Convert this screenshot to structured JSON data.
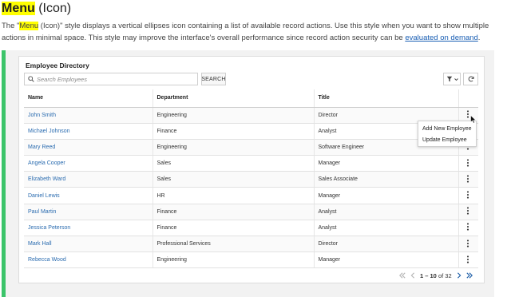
{
  "heading": {
    "highlight": "Menu",
    "rest": " (Icon)"
  },
  "description": {
    "part1": "The \"",
    "highlight": "Menu",
    "part2": " (Icon)\" style displays a vertical ellipses icon containing a list of available record actions. Use this style when you want to show multiple actions in minimal space. This style may improve the interface's overall performance since record action security can be ",
    "link": "evaluated on demand",
    "part3": "."
  },
  "card": {
    "title": "Employee Directory",
    "search_placeholder": "Search Employees",
    "search_button": "SEARCH"
  },
  "table": {
    "columns": [
      "Name",
      "Department",
      "Title",
      ""
    ],
    "rows": [
      {
        "name": "John Smith",
        "department": "Engineering",
        "title": "Director"
      },
      {
        "name": "Michael Johnson",
        "department": "Finance",
        "title": "Analyst"
      },
      {
        "name": "Mary Reed",
        "department": "Engineering",
        "title": "Software Engineer"
      },
      {
        "name": "Angela Cooper",
        "department": "Sales",
        "title": "Manager"
      },
      {
        "name": "Elizabeth Ward",
        "department": "Sales",
        "title": "Sales Associate"
      },
      {
        "name": "Daniel Lewis",
        "department": "HR",
        "title": "Manager"
      },
      {
        "name": "Paul Martin",
        "department": "Finance",
        "title": "Analyst"
      },
      {
        "name": "Jessica Peterson",
        "department": "Finance",
        "title": "Analyst"
      },
      {
        "name": "Mark Hall",
        "department": "Professional Services",
        "title": "Director"
      },
      {
        "name": "Rebecca Wood",
        "department": "Engineering",
        "title": "Manager"
      }
    ]
  },
  "action_menu": {
    "items": [
      "Add New Employee",
      "Update Employee"
    ]
  },
  "pagination": {
    "range": "1 – 10",
    "of_label": " of ",
    "total": "32"
  },
  "colors": {
    "accent_bar": "#3cc46a",
    "link": "#2b6cb0",
    "highlight": "#ffff00"
  },
  "icons": [
    "search-icon",
    "filter-icon",
    "chevron-down-icon",
    "refresh-icon",
    "kebab-menu-icon",
    "first-page-icon",
    "prev-page-icon",
    "next-page-icon",
    "last-page-icon",
    "mouse-cursor-icon"
  ]
}
